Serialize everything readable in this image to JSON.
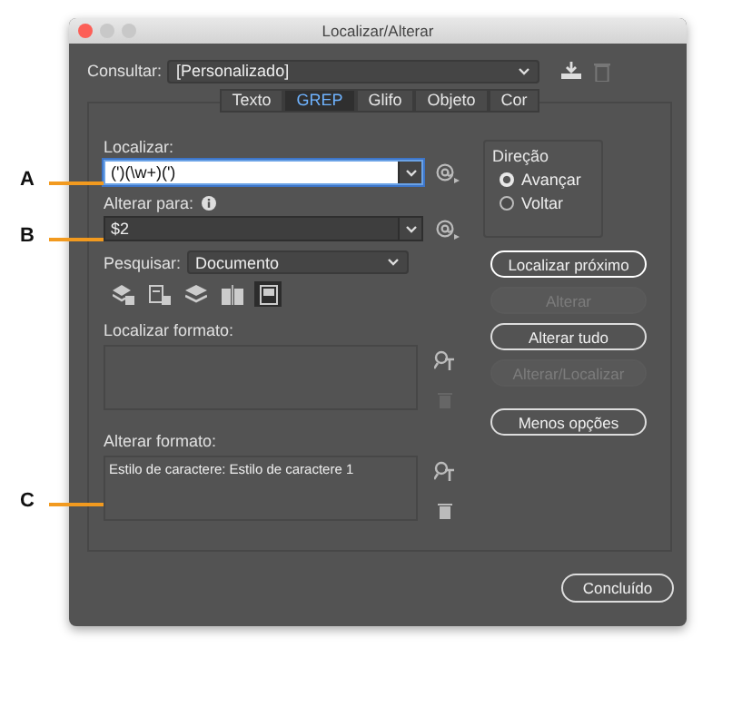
{
  "window": {
    "title": "Localizar/Alterar"
  },
  "query": {
    "label": "Consultar:",
    "value": "[Personalizado]"
  },
  "tabs": [
    {
      "label": "Texto",
      "selected": false
    },
    {
      "label": "GREP",
      "selected": true
    },
    {
      "label": "Glifo",
      "selected": false
    },
    {
      "label": "Objeto",
      "selected": false
    },
    {
      "label": "Cor",
      "selected": false
    }
  ],
  "find": {
    "label": "Localizar:",
    "value": "(')(\\w+)(')",
    "focused": true
  },
  "change": {
    "label": "Alterar para:",
    "value": "$2",
    "focused": false
  },
  "search": {
    "label": "Pesquisar:",
    "value": "Documento"
  },
  "option_toggles": [
    {
      "selected": false
    },
    {
      "selected": false
    },
    {
      "selected": false
    },
    {
      "selected": false
    },
    {
      "selected": true
    }
  ],
  "find_format": {
    "label": "Localizar formato:"
  },
  "change_format": {
    "label": "Alterar formato:",
    "value": "Estilo de caractere: Estilo de caractere 1"
  },
  "direction": {
    "label": "Direção",
    "options": [
      {
        "label": "Avançar",
        "selected": true
      },
      {
        "label": "Voltar",
        "selected": false
      }
    ]
  },
  "buttons": [
    {
      "label": "Localizar próximo",
      "disabled": false,
      "default": true
    },
    {
      "label": "Alterar",
      "disabled": true,
      "default": false
    },
    {
      "label": "Alterar tudo",
      "disabled": false,
      "default": false
    },
    {
      "label": "Alterar/Localizar",
      "disabled": true,
      "default": false
    },
    {
      "label": "Menos opções",
      "disabled": false,
      "default": false
    }
  ],
  "done_button": {
    "label": "Concluído"
  },
  "callouts": [
    {
      "label": "A"
    },
    {
      "label": "B"
    },
    {
      "label": "C"
    }
  ]
}
